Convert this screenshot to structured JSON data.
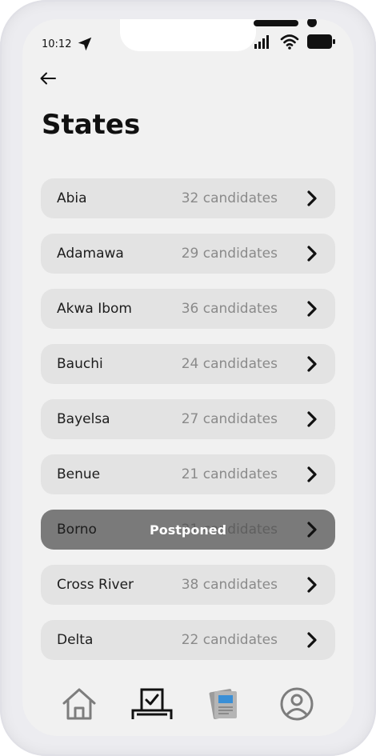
{
  "status_bar": {
    "time": "10:12",
    "icons": [
      "location-arrow-icon",
      "signal-icon",
      "wifi-icon",
      "battery-icon"
    ]
  },
  "header": {
    "back_icon": "arrow-left-icon",
    "title": "States"
  },
  "states": [
    {
      "name": "Abia",
      "count": "32 candidates"
    },
    {
      "name": "Adamawa",
      "count": "29 candidates"
    },
    {
      "name": "Akwa Ibom",
      "count": "36 candidates"
    },
    {
      "name": "Bauchi",
      "count": "24 candidates"
    },
    {
      "name": "Bayelsa",
      "count": "27 candidates"
    },
    {
      "name": "Benue",
      "count": "21 candidates"
    },
    {
      "name": "Borno",
      "count": "21 candidates",
      "badge": "Postponed"
    },
    {
      "name": "Cross River",
      "count": "38 candidates"
    },
    {
      "name": "Delta",
      "count": "22 candidates"
    }
  ],
  "tabbar": {
    "items": [
      "home-icon",
      "ballot-box-icon",
      "newspaper-icon",
      "profile-icon"
    ],
    "active": "ballot-box-icon"
  },
  "colors": {
    "row_bg": "#e3e3e3",
    "postponed_bg": "#7a7a7a",
    "screen_bg": "#f1f1f1"
  }
}
